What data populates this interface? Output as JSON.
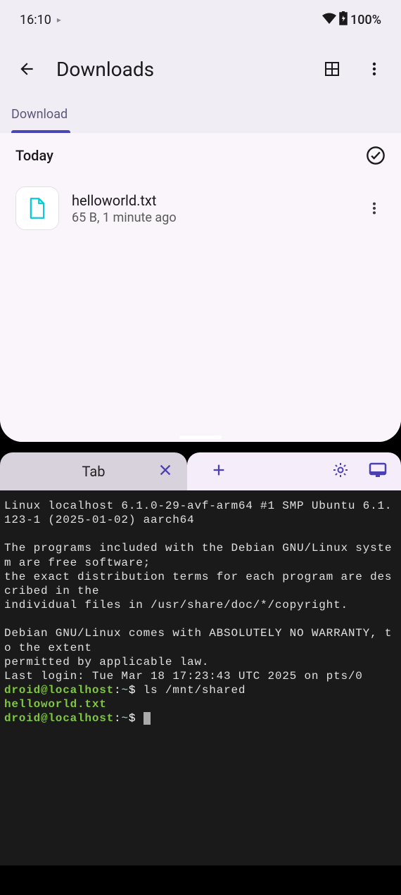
{
  "status": {
    "time": "16:10",
    "battery": "100%"
  },
  "header": {
    "title": "Downloads"
  },
  "tabs": {
    "download": "Download"
  },
  "section": {
    "title": "Today"
  },
  "files": [
    {
      "name": "helloworld.txt",
      "meta": "65 B, 1 minute ago"
    }
  ],
  "terminal": {
    "tab_label": "Tab",
    "lines": {
      "l1": "Linux localhost 6.1.0-29-avf-arm64 #1 SMP Ubuntu 6.1.123-1 (2025-01-02) aarch64",
      "l2": "The programs included with the Debian GNU/Linux system are free software;",
      "l3": "the exact distribution terms for each program are described in the",
      "l4": "individual files in /usr/share/doc/*/copyright.",
      "l5": "Debian GNU/Linux comes with ABSOLUTELY NO WARRANTY, to the extent",
      "l6": "permitted by applicable law.",
      "l7": "Last login: Tue Mar 18 17:23:43 UTC 2025 on pts/0",
      "prompt1_user": "droid@localhost",
      "prompt1_path": "~",
      "prompt1_cmd": "ls /mnt/shared",
      "out1": "helloworld.txt",
      "prompt2_user": "droid@localhost",
      "prompt2_path": "~"
    }
  }
}
